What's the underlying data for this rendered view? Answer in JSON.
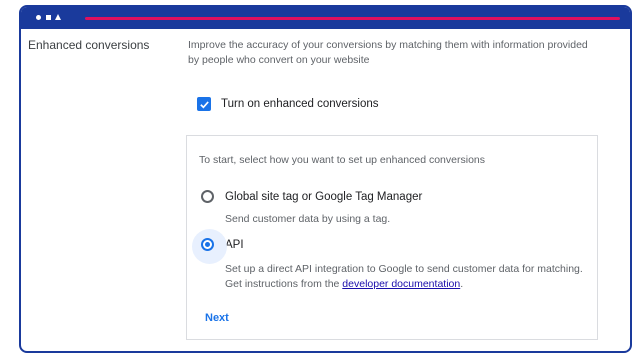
{
  "section": {
    "label": "Enhanced conversions",
    "description": "Improve the accuracy of your conversions by matching them with information provided by people who convert on your website"
  },
  "checkbox": {
    "label": "Turn on enhanced conversions",
    "checked": true,
    "icon": "checkmark-icon"
  },
  "panel": {
    "intro": "To start, select how you want to set up enhanced conversions",
    "options": [
      {
        "label": "Global site tag or Google Tag Manager",
        "description": "Send customer data by using a tag.",
        "selected": false
      },
      {
        "label": "API",
        "description_before_link": "Set up a direct API integration to Google to send customer data for matching. Get instructions from the ",
        "link_text": "developer documentation",
        "description_after_link": ".",
        "selected": true
      }
    ],
    "next_label": "Next"
  },
  "colors": {
    "frame": "#1a3a9c",
    "accent": "#e0105e",
    "primary": "#1a73e8",
    "link": "#1a0dab"
  }
}
